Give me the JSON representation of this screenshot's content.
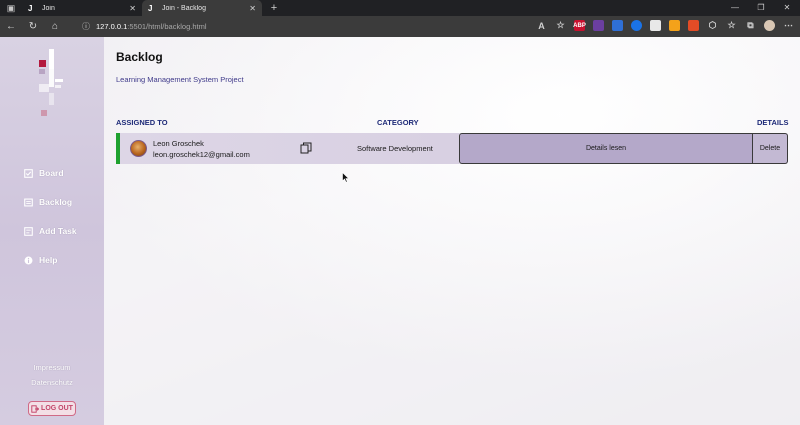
{
  "browser": {
    "tabs": [
      {
        "title": "Join",
        "active": false,
        "favicon": "join-logo"
      },
      {
        "title": "Join - Backlog",
        "active": true,
        "favicon": "join-logo"
      }
    ],
    "url_host": "127.0.0.1",
    "url_path": ":5501/html/backlog.html",
    "new_tab": "+",
    "extension_badges": [
      "ABP"
    ]
  },
  "sidebar": {
    "items": [
      {
        "label": "Board",
        "icon": "board-icon"
      },
      {
        "label": "Backlog",
        "icon": "backlog-icon"
      },
      {
        "label": "Add Task",
        "icon": "add-task-icon"
      },
      {
        "label": "Help",
        "icon": "help-icon"
      }
    ],
    "impressum": "Impressum",
    "datenschutz": "Datenschutz",
    "logout": "LOG OUT"
  },
  "main": {
    "title": "Backlog",
    "subtitle": "Learning Management System Project",
    "columns": {
      "assigned": "ASSIGNED TO",
      "category": "CATEGORY",
      "details": "DETAILS"
    },
    "rows": [
      {
        "name": "Leon Groschek",
        "email": "leon.groschek12@gmail.com",
        "category": "Software Development",
        "details_label": "Details lesen",
        "delete_label": "Delete",
        "accent_color": "#1fa12f"
      }
    ]
  },
  "colors": {
    "sidebar": "#d5cce0",
    "heading_blue": "#1e2a78",
    "row_accent": "#1fa12f",
    "details_button": "#b4a8c9",
    "logout": "#c2466a"
  }
}
